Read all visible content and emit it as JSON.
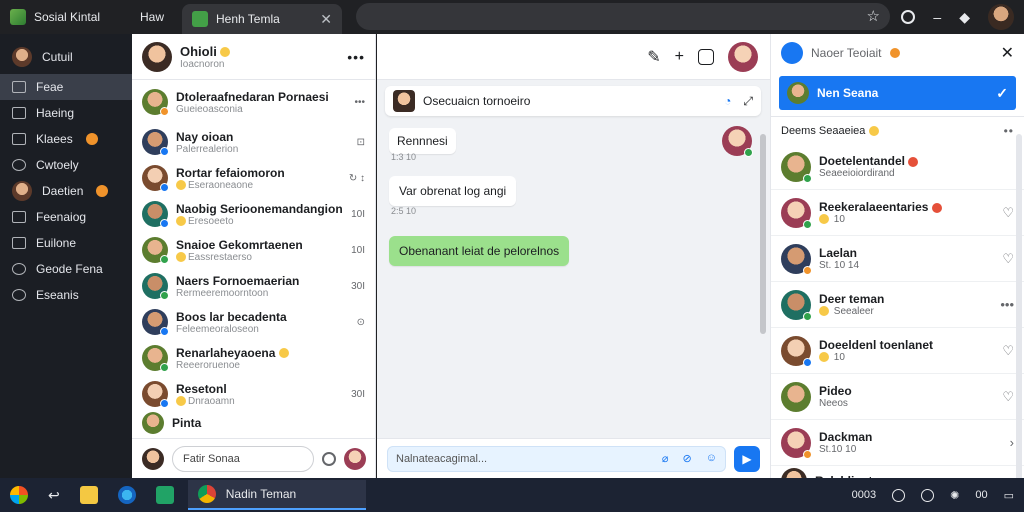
{
  "browser": {
    "tabs": [
      {
        "label": "Sosial Kintal"
      },
      {
        "label": "Haw"
      },
      {
        "label": "Henh Temla"
      }
    ],
    "close_glyph": "✕",
    "star_glyph": "☆"
  },
  "sidebar": {
    "items": [
      {
        "label": "Cutuil",
        "icon": "avatar"
      },
      {
        "label": "Feae",
        "icon": "home-icon"
      },
      {
        "label": "Haeing",
        "icon": "monitor-icon"
      },
      {
        "label": "Klaees",
        "icon": "video-icon"
      },
      {
        "label": "Cwtoely",
        "icon": "group-icon"
      },
      {
        "label": "Daetien",
        "icon": "avatar"
      },
      {
        "label": "Feenaiog",
        "icon": "calendar-icon"
      },
      {
        "label": "Euilone",
        "icon": "book-icon"
      },
      {
        "label": "Geode Fena",
        "icon": "clock-icon"
      },
      {
        "label": "Eseanis",
        "icon": "help-icon"
      }
    ]
  },
  "chat_list": {
    "header": {
      "name": "Ohioli",
      "status": "Ioacnoron",
      "more": "•••"
    },
    "conversations": [
      {
        "name": "Dtoleraafnedaran Pornaesi",
        "preview": "Gueieoasconia",
        "meta": "•••",
        "dot": "orange",
        "avatar": "av-e"
      },
      {
        "name": "Nay oioan",
        "preview": "Palerrealerion",
        "meta": "⊡",
        "dot": "blue",
        "avatar": "av-b"
      },
      {
        "name": "Rortar fefaiomoron",
        "preview": "Eseraoneaone",
        "meta": "↻ ↕",
        "dot": "blue",
        "avatar": "av-c"
      },
      {
        "name": "Naobig Serioonemandangion",
        "preview": "Eresoeeto",
        "meta": "10I",
        "dot": "blue",
        "avatar": "av-d"
      },
      {
        "name": "Snaioe Gekomrtaenen",
        "preview": "Eassrestaerso",
        "meta": "10I",
        "dot": "green",
        "avatar": "av-e"
      },
      {
        "name": "Naers Fornoemaerian",
        "preview": "Rermeeremoorntoon",
        "meta": "30I",
        "dot": "green",
        "avatar": "av-d"
      },
      {
        "name": "Boos lar becadenta",
        "preview": "Feleemeoraloseon",
        "meta": "⊙",
        "dot": "blue",
        "avatar": "av-b"
      },
      {
        "name": "Renarlaheyaoena",
        "preview": "Reeeroruenoe",
        "meta": "",
        "dot": "green",
        "avatar": "av-e"
      },
      {
        "name": "Resetonl",
        "preview": "Dnraoamn",
        "meta": "30I",
        "dot": "blue",
        "avatar": "av-c"
      },
      {
        "name": "Pinta",
        "preview": "",
        "meta": "",
        "dot": "green",
        "avatar": "av-e"
      }
    ],
    "search_placeholder": "Fatir Sonaa"
  },
  "chat": {
    "top_icons": [
      "pencil-icon",
      "plus-icon",
      "compose-icon",
      "profile-avatar"
    ],
    "search_text": "Osecuaicn tornoeiro",
    "messages": [
      {
        "text": "Rennnesi",
        "time": "1:3 10",
        "color": "white"
      },
      {
        "text": "Var obrenat log angi",
        "time": "2:5 10",
        "color": "white"
      },
      {
        "text": "Obenanant leiat de pelorelnos",
        "time": "",
        "color": "green"
      }
    ],
    "compose_placeholder": "Nalnateacagimal...",
    "send_glyph": "▶"
  },
  "right_panel": {
    "title": "Naoer Teoiait",
    "close_glyph": "✕",
    "selected": {
      "name": "Nen Seana",
      "check": "✓"
    },
    "section": {
      "label": "Deems Seaaeiea",
      "more": "••"
    },
    "contacts": [
      {
        "name": "Doetelentandel",
        "status": "Seaeeioiordirand",
        "action": "",
        "dot": "green",
        "avatar": "av-e"
      },
      {
        "name": "Reekeralaeentaries",
        "status": "10",
        "action": "♡",
        "dot": "green",
        "avatar": "av-f"
      },
      {
        "name": "Laelan",
        "status": "St. 10 14",
        "action": "♡",
        "dot": "orange",
        "avatar": "av-b"
      },
      {
        "name": "Deer teman",
        "status": "Seealeer",
        "action": "•••",
        "dot": "green",
        "avatar": "av-d"
      },
      {
        "name": "Doeeldenl toenlanet",
        "status": "10",
        "action": "♡",
        "dot": "blue",
        "avatar": "av-c"
      },
      {
        "name": "Pideo",
        "status": "Neeos",
        "action": "♡",
        "dot": "",
        "avatar": "av-e"
      },
      {
        "name": "Dackman",
        "status": "St.10 10",
        "action": "›",
        "dot": "orange",
        "avatar": "av-f"
      },
      {
        "name": "Relehlioet",
        "status": "",
        "action": "↕",
        "dot": "",
        "avatar": "av-a"
      }
    ]
  },
  "taskbar": {
    "active_app": "Nadin Teman",
    "tray_text": "0003",
    "tray_text2": "00"
  }
}
